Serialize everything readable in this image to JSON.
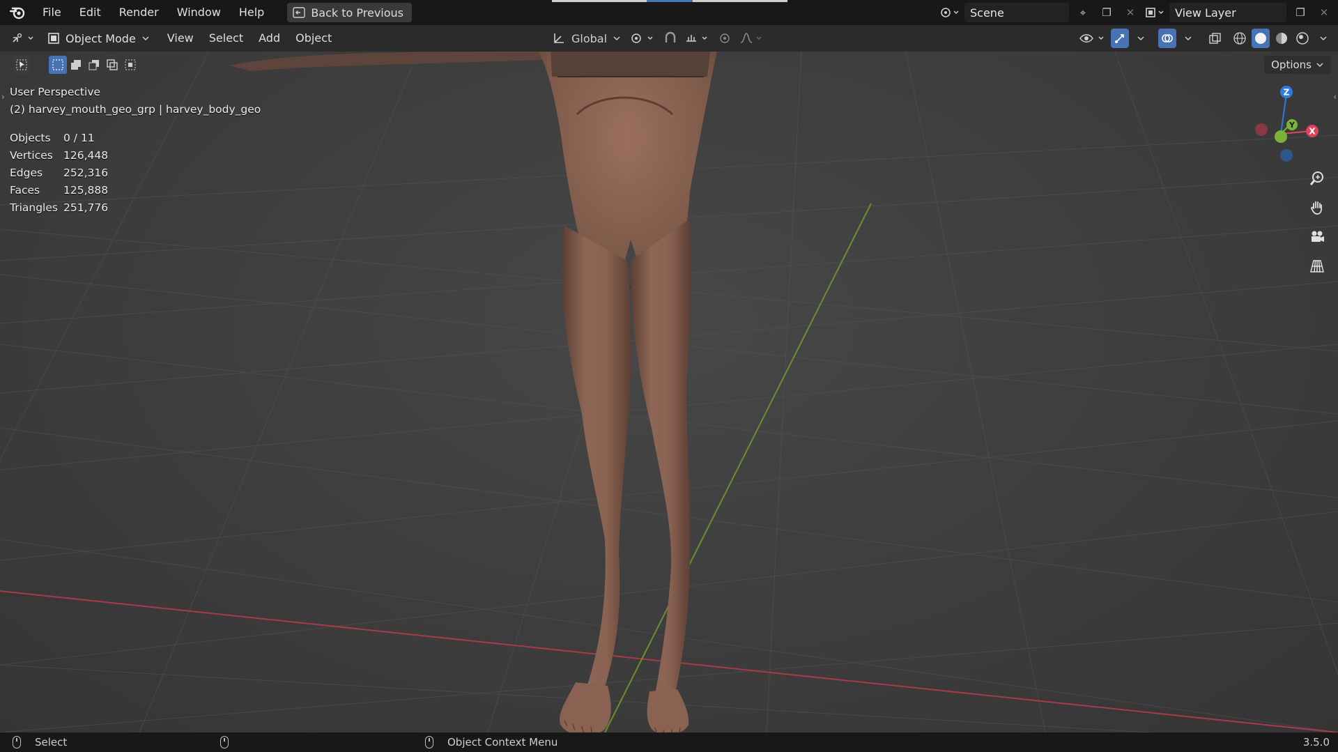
{
  "menu": {
    "items": [
      "File",
      "Edit",
      "Render",
      "Window",
      "Help"
    ],
    "back_button": "Back to Previous",
    "logo_icon": "blender-logo-icon"
  },
  "scene": {
    "label": "Scene",
    "view_layer": "View Layer"
  },
  "view_header": {
    "mode": "Object Mode",
    "menus": [
      "View",
      "Select",
      "Add",
      "Object"
    ],
    "orientation": "Global"
  },
  "viewport": {
    "options_label": "Options",
    "perspective": "User Perspective",
    "active_object": "(2) harvey_mouth_geo_grp | harvey_body_geo",
    "stats": [
      {
        "label": "Objects",
        "value": "0 / 11"
      },
      {
        "label": "Vertices",
        "value": "126,448"
      },
      {
        "label": "Edges",
        "value": "252,316"
      },
      {
        "label": "Faces",
        "value": "125,888"
      },
      {
        "label": "Triangles",
        "value": "251,776"
      }
    ],
    "gizmo": {
      "z": "Z",
      "y": "Y",
      "x": "X"
    }
  },
  "status": {
    "left_action": "Select",
    "context_action": "Object Context Menu",
    "version": "3.5.0"
  },
  "colors": {
    "accent": "#4772b3",
    "axis_x": "#e0445b",
    "axis_y": "#7ab33a",
    "axis_z": "#2f7ae0",
    "skin": "#8a6352"
  }
}
